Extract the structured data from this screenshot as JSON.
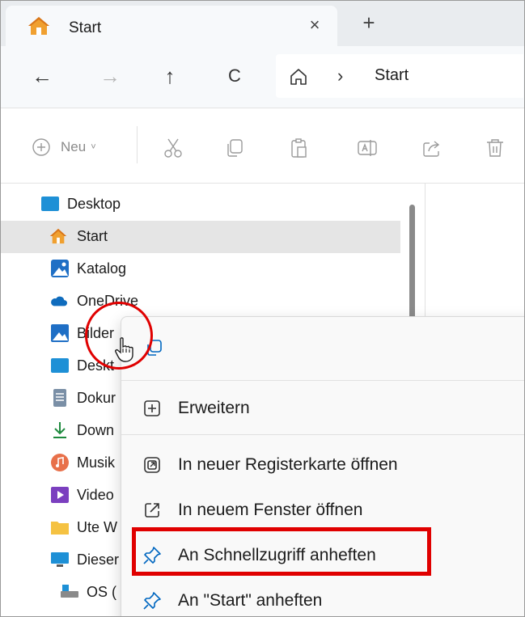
{
  "tab": {
    "title": "Start",
    "close_icon": "×",
    "new_tab_icon": "+"
  },
  "nav": {
    "back_icon": "←",
    "forward_icon": "→",
    "up_icon": "↑",
    "refresh_icon": "C",
    "address": {
      "separator": "›",
      "location": "Start"
    }
  },
  "toolbar": {
    "new_label": "Neu",
    "new_caret": "˅",
    "icons": [
      "cut-icon",
      "copy-icon",
      "paste-icon",
      "rename-icon",
      "share-icon",
      "delete-icon"
    ]
  },
  "sidebar": {
    "items": [
      {
        "label": "Desktop",
        "icon": "desktop-icon"
      },
      {
        "label": "Start",
        "icon": "home-icon",
        "selected": true
      },
      {
        "label": "Katalog",
        "icon": "gallery-icon"
      },
      {
        "label": "OneDrive",
        "icon": "cloud-icon"
      },
      {
        "label": "Bilder",
        "icon": "pictures-icon"
      },
      {
        "label": "Deskt",
        "icon": "desktop-folder-icon"
      },
      {
        "label": "Dokur",
        "icon": "documents-icon"
      },
      {
        "label": "Down",
        "icon": "download-icon"
      },
      {
        "label": "Musik",
        "icon": "music-icon"
      },
      {
        "label": "Video",
        "icon": "video-icon"
      },
      {
        "label": "Ute W",
        "icon": "folder-icon"
      },
      {
        "label": "Dieser",
        "icon": "pc-icon"
      },
      {
        "label": "OS (",
        "icon": "drive-icon"
      }
    ]
  },
  "context_menu": {
    "items": [
      {
        "label": "Erweitern",
        "icon": "expand-icon"
      },
      {
        "label": "In neuer Registerkarte öffnen",
        "icon": "new-tab-icon"
      },
      {
        "label": "In neuem Fenster öffnen",
        "icon": "new-window-icon"
      },
      {
        "label": "An Schnellzugriff anheften",
        "icon": "pin-icon",
        "highlighted": true
      },
      {
        "label": "An \"Start\" anheften",
        "icon": "pin-icon"
      }
    ]
  },
  "colors": {
    "accent": "#0067c0",
    "highlight": "#e00000",
    "folder": "#f5c242"
  }
}
